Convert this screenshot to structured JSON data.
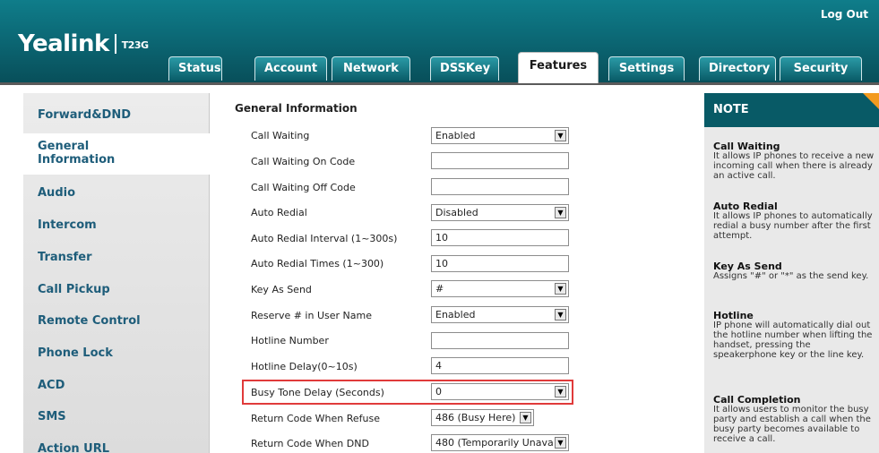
{
  "header": {
    "brand": "Yealink",
    "model": "T23G",
    "logout": "Log Out",
    "tabs": [
      "Status",
      "Account",
      "Network",
      "DSSKey",
      "Features",
      "Settings",
      "Directory",
      "Security"
    ],
    "active_tab": "Features"
  },
  "sidebar": {
    "items": [
      "Forward&DND",
      "General Information",
      "Audio",
      "Intercom",
      "Transfer",
      "Call Pickup",
      "Remote Control",
      "Phone Lock",
      "ACD",
      "SMS",
      "Action URL"
    ],
    "active": "General Information"
  },
  "main": {
    "section_title": "General Information",
    "rows": [
      {
        "label": "Call Waiting",
        "type": "select",
        "value": "Enabled"
      },
      {
        "label": "Call Waiting On Code",
        "type": "input",
        "value": ""
      },
      {
        "label": "Call Waiting Off Code",
        "type": "input",
        "value": ""
      },
      {
        "label": "Auto Redial",
        "type": "select",
        "value": "Disabled"
      },
      {
        "label": "Auto Redial Interval (1~300s)",
        "type": "input",
        "value": "10"
      },
      {
        "label": "Auto Redial Times (1~300)",
        "type": "input",
        "value": "10"
      },
      {
        "label": "Key As Send",
        "type": "select",
        "value": "#"
      },
      {
        "label": "Reserve # in User Name",
        "type": "select",
        "value": "Enabled"
      },
      {
        "label": "Hotline Number",
        "type": "input",
        "value": ""
      },
      {
        "label": "Hotline Delay(0~10s)",
        "type": "input",
        "value": "4"
      },
      {
        "label": "Busy Tone Delay (Seconds)",
        "type": "select",
        "value": "0"
      },
      {
        "label": "Return Code When Refuse",
        "type": "select",
        "value": "486 (Busy Here)"
      },
      {
        "label": "Return Code When DND",
        "type": "select",
        "value": "480 (Temporarily Unava"
      }
    ]
  },
  "note": {
    "heading": "NOTE",
    "blocks": [
      {
        "title": "Call Waiting",
        "text": "It allows IP phones to receive a new incoming call when there is already an active call."
      },
      {
        "title": "Auto Redial",
        "text": "It allows IP phones to automatically redial a busy number after the first attempt."
      },
      {
        "title": "Key As Send",
        "text": "Assigns \"#\" or \"*\" as the send key."
      },
      {
        "title": "Hotline",
        "text": "IP phone will automatically dial out the hotline number when lifting the handset, pressing the speakerphone key or the line key."
      },
      {
        "title": "Call Completion",
        "text": "It allows users to monitor the busy party and establish a call when the busy party becomes available to receive a call."
      }
    ]
  },
  "colors": {
    "brand": "#0c6b78",
    "accent": "#f39a1f",
    "highlight": "#e03a3a",
    "link": "#1e5d7a"
  }
}
